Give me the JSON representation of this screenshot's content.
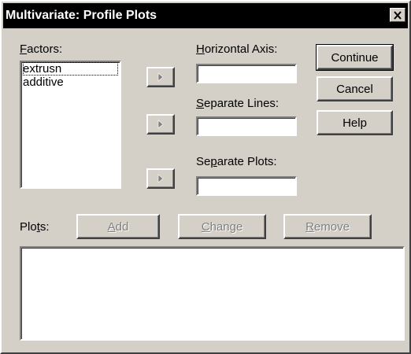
{
  "window": {
    "title": "Multivariate: Profile Plots",
    "close_glyph": "✕"
  },
  "factors": {
    "label_mnemonic": "F",
    "label_rest": "actors:",
    "items": [
      "extrusn",
      "additive"
    ]
  },
  "horizontal_axis": {
    "label_mnemonic": "H",
    "label_rest": "orizontal Axis:",
    "value": ""
  },
  "separate_lines": {
    "label_mnemonic": "S",
    "label_rest": "eparate Lines:",
    "value": ""
  },
  "separate_plots": {
    "label_pre": "Se",
    "label_mnemonic": "p",
    "label_rest": "arate Plots:",
    "value": ""
  },
  "buttons": {
    "continue": "Continue",
    "cancel": "Cancel",
    "help": "Help"
  },
  "plots": {
    "label_pre": "Plo",
    "label_mnemonic": "t",
    "label_rest": "s:",
    "add_mnemonic": "A",
    "add_rest": "dd",
    "change_mnemonic": "C",
    "change_rest": "hange",
    "remove_mnemonic": "R",
    "remove_rest": "emove",
    "items": []
  },
  "icons": {
    "move_arrow": "right-triangle-icon",
    "close": "close-icon"
  }
}
